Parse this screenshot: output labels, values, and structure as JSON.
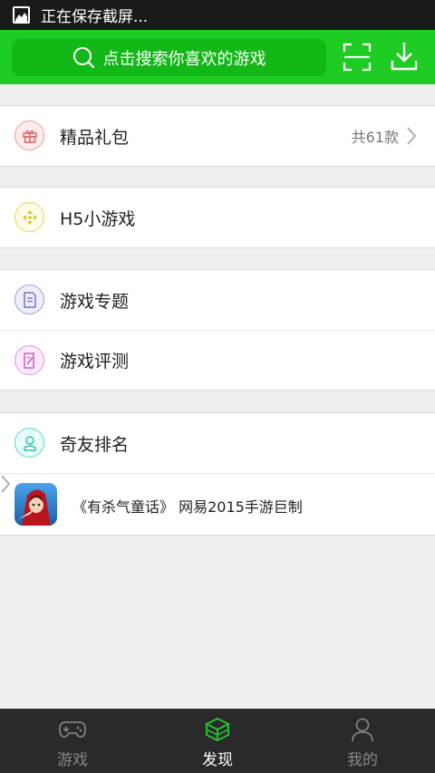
{
  "status_bar": {
    "text": "正在保存截屏..."
  },
  "header": {
    "search_placeholder": "点击搜索你喜欢的游戏"
  },
  "sections": {
    "gift": {
      "label": "精品礼包",
      "count": "共61款"
    },
    "h5": {
      "label": "H5小游戏"
    },
    "topic": {
      "label": "游戏专题"
    },
    "review": {
      "label": "游戏评测"
    },
    "rank": {
      "label": "奇友排名"
    },
    "promo": {
      "text": "《有杀气童话》 网易2015手游巨制"
    }
  },
  "tabs": [
    {
      "label": "游戏",
      "icon": "gamepad-icon"
    },
    {
      "label": "发现",
      "icon": "cube-icon",
      "active": true
    },
    {
      "label": "我的",
      "icon": "person-icon"
    }
  ],
  "colors": {
    "brand": "#1fcc24",
    "tab_active_icon": "#22d12a"
  }
}
